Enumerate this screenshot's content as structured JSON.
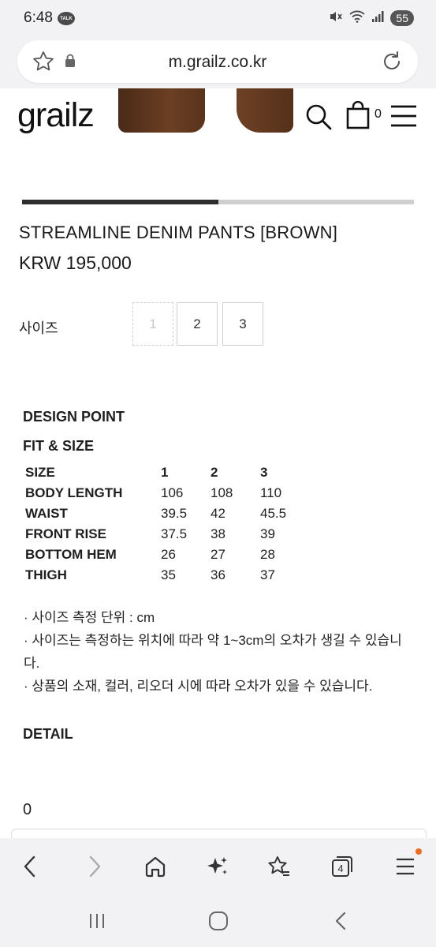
{
  "status_bar": {
    "time": "6:48",
    "talk_badge": "TALK",
    "battery": "55"
  },
  "browser": {
    "url": "m.grailz.co.kr",
    "tab_count": "4"
  },
  "site": {
    "logo": "grailz",
    "cart_count": "0"
  },
  "gallery": {
    "progress": 0.5
  },
  "product": {
    "title": "STREAMLINE DENIM PANTS [BROWN]",
    "price": "KRW 195,000",
    "size_label": "사이즈",
    "sizes": [
      {
        "label": "1",
        "available": false
      },
      {
        "label": "2",
        "available": true
      },
      {
        "label": "3",
        "available": true
      }
    ]
  },
  "description": {
    "design_point_title": "DESIGN POINT",
    "fit_size_title": "FIT & SIZE",
    "table": {
      "header": {
        "label": "SIZE",
        "values": [
          "1",
          "2",
          "3"
        ]
      },
      "rows": [
        {
          "label": "BODY LENGTH",
          "values": [
            "106",
            "108",
            "110"
          ]
        },
        {
          "label": "WAIST",
          "values": [
            "39.5",
            "42",
            "45.5"
          ]
        },
        {
          "label": "FRONT RISE",
          "values": [
            "37.5",
            "38",
            "39"
          ]
        },
        {
          "label": "BOTTOM HEM",
          "values": [
            "26",
            "27",
            "28"
          ]
        },
        {
          "label": "THIGH",
          "values": [
            "35",
            "36",
            "37"
          ]
        }
      ]
    },
    "notes": [
      "· 사이즈 측정 단위 : cm",
      "· 사이즈는 측정하는 위치에 따라 약 1~3cm의 오차가 생길 수 있습니다.",
      "· 상품의 소재, 컬러, 리오더 시에 따라 오차가 있을 수 있습니다."
    ],
    "detail_title": "DETAIL",
    "review_count": "0"
  },
  "toolbar_icons": [
    "back-icon",
    "forward-icon",
    "home-icon",
    "sparkle-icon",
    "bookmark-star-icon",
    "tabs-icon",
    "menu-icon"
  ],
  "colors": {
    "chrome_bg": "#f2f2f4",
    "hero_brown": "#5a331c",
    "notification_dot": "#f36b1c",
    "slider_fill": "#2e2e2e",
    "slider_track": "#cfcfcf"
  }
}
